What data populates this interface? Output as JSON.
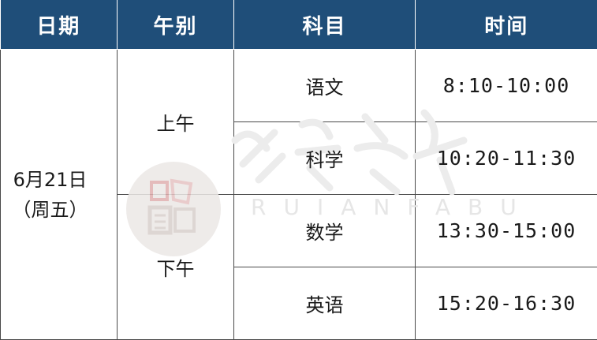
{
  "table": {
    "headers": [
      "日期",
      "午别",
      "科目",
      "时间"
    ],
    "date": {
      "line1": "6月21日",
      "line2": "（周五）"
    },
    "sessions": [
      "上午",
      "下午"
    ],
    "rows": [
      {
        "subject": "语文",
        "time": "8:10-10:00"
      },
      {
        "subject": "科学",
        "time": "10:20-11:30"
      },
      {
        "subject": "数学",
        "time": "13:30-15:00"
      },
      {
        "subject": "英语",
        "time": "15:20-16:30"
      }
    ]
  },
  "watermark": {
    "latin": "RUIANFABU"
  },
  "colors": {
    "header_bg": "#1f4e79",
    "header_text": "#ffffff",
    "border": "#4a4a4a",
    "watermark": "#e6e6e6"
  }
}
